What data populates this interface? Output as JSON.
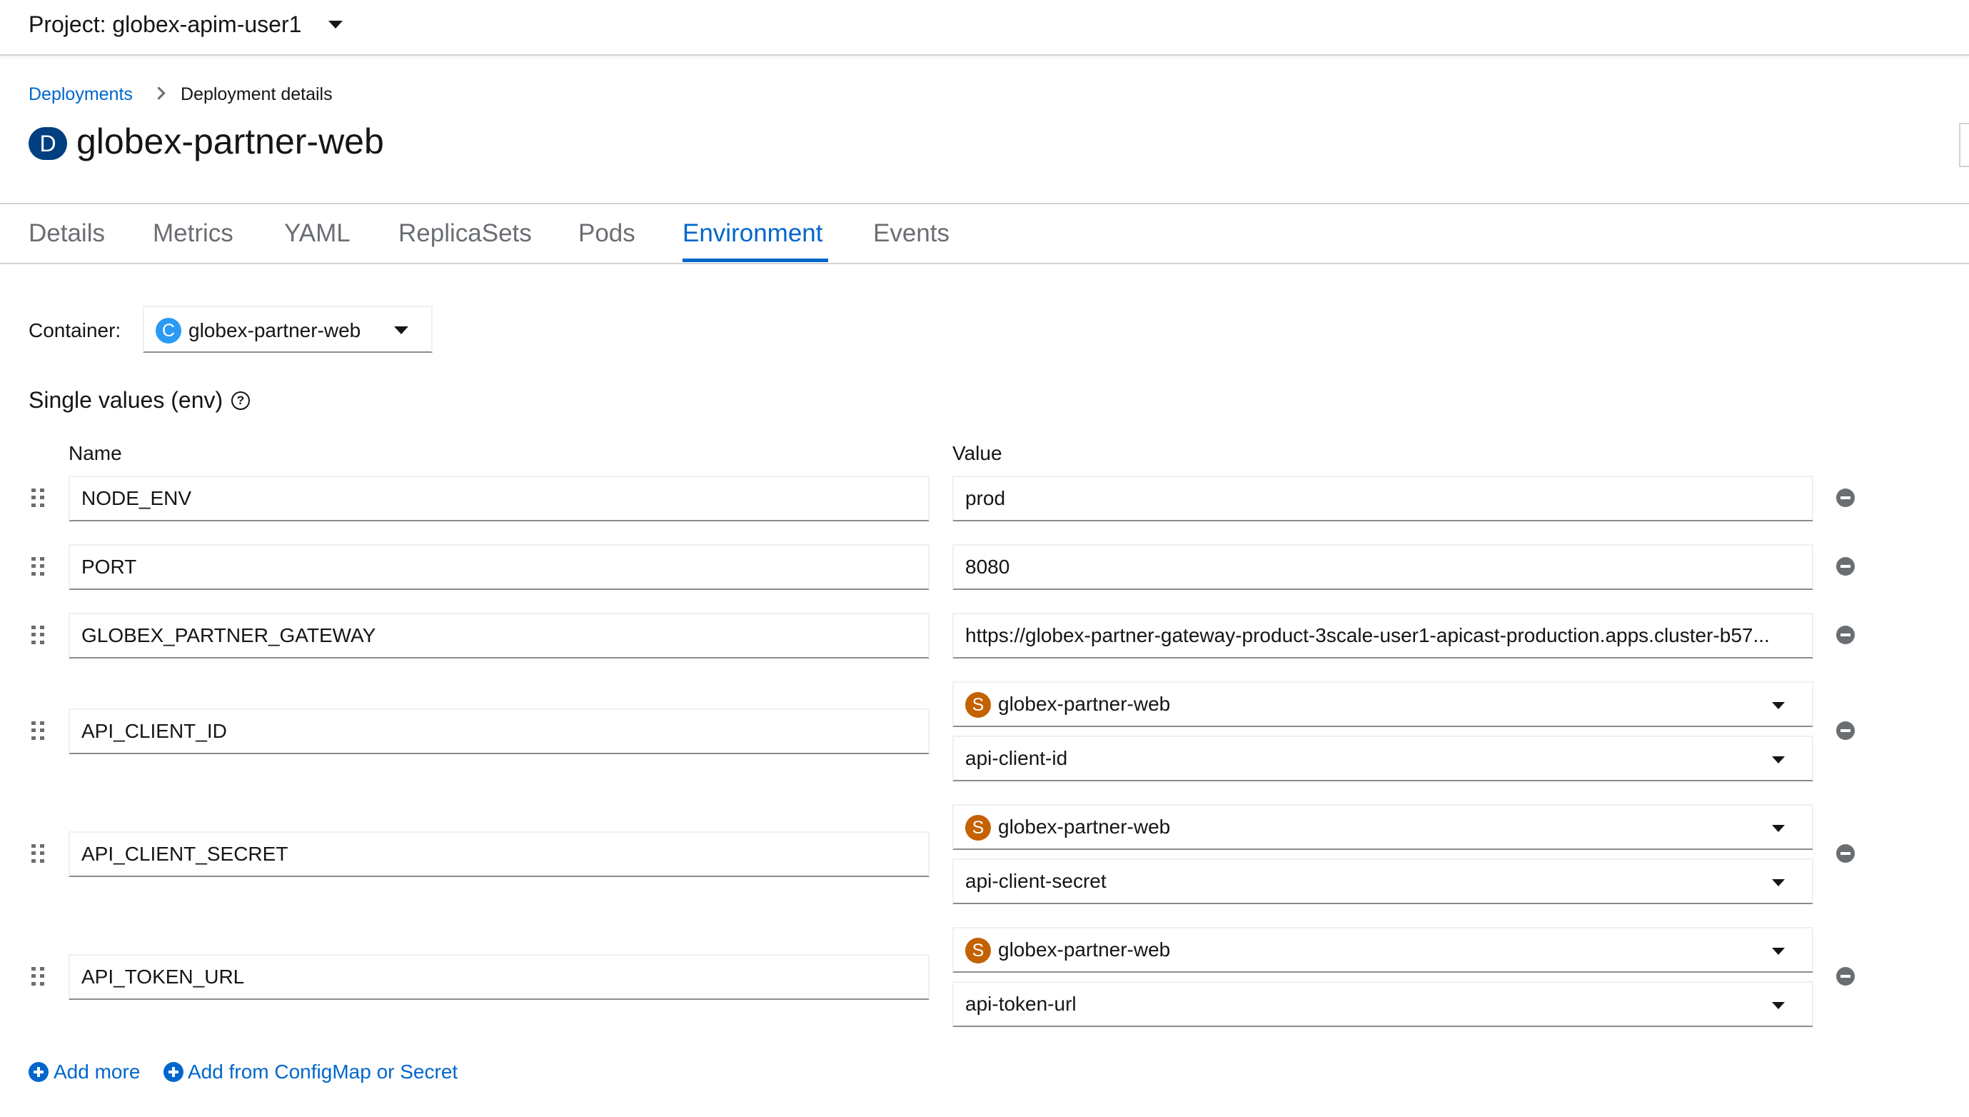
{
  "project": {
    "label": "Project: globex-apim-user1"
  },
  "breadcrumb": {
    "parent": "Deployments",
    "current": "Deployment details"
  },
  "header": {
    "badge": "D",
    "title": "globex-partner-web"
  },
  "tabs": [
    "Details",
    "Metrics",
    "YAML",
    "ReplicaSets",
    "Pods",
    "Environment",
    "Events"
  ],
  "active_tab": "Environment",
  "container": {
    "label": "Container:",
    "badge": "C",
    "value": "globex-partner-web"
  },
  "section": {
    "title": "Single values (env)",
    "help_glyph": "?"
  },
  "columns": {
    "name": "Name",
    "value": "Value"
  },
  "env_rows": [
    {
      "name": "NODE_ENV",
      "value": "prod"
    },
    {
      "name": "PORT",
      "value": "8080"
    },
    {
      "name": "GLOBEX_PARTNER_GATEWAY",
      "value": "https://globex-partner-gateway-product-3scale-user1-apicast-production.apps.cluster-b57..."
    },
    {
      "name": "API_CLIENT_ID",
      "secret_badge": "S",
      "secret": "globex-partner-web",
      "key": "api-client-id"
    },
    {
      "name": "API_CLIENT_SECRET",
      "secret_badge": "S",
      "secret": "globex-partner-web",
      "key": "api-client-secret"
    },
    {
      "name": "API_TOKEN_URL",
      "secret_badge": "S",
      "secret": "globex-partner-web",
      "key": "api-token-url"
    }
  ],
  "actions": {
    "add_more": "Add more",
    "add_from": "Add from ConfigMap or Secret"
  },
  "colors": {
    "link": "#0066cc",
    "resource_badge": "#004080",
    "container_badge": "#2b9af3",
    "secret_badge": "#c46100"
  }
}
